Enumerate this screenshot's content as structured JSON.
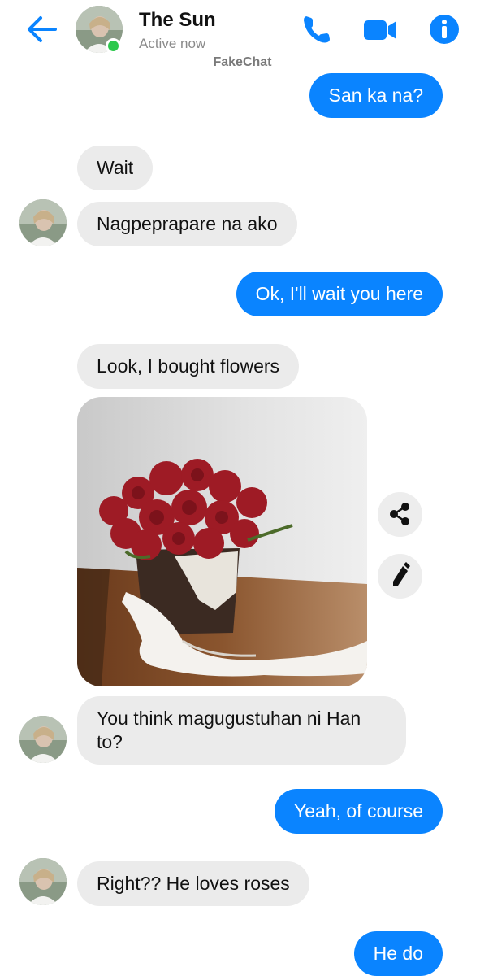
{
  "header": {
    "contact_name": "The Sun",
    "status": "Active now",
    "watermark": "FakeChat",
    "icons": [
      "back-arrow-icon",
      "phone-icon",
      "video-camera-icon",
      "info-icon"
    ],
    "colors": {
      "accent": "#0a84ff",
      "online": "#2dc84d"
    }
  },
  "messages": [
    {
      "direction": "outgoing",
      "text": "San ka na?"
    },
    {
      "direction": "incoming",
      "text": "Wait"
    },
    {
      "direction": "incoming",
      "text": "Nagpeprapare na ako"
    },
    {
      "direction": "outgoing",
      "text": "Ok, I'll wait you here"
    },
    {
      "direction": "incoming",
      "text": "Look, I bought flowers"
    },
    {
      "direction": "incoming",
      "type": "image",
      "content": "photo of red roses in a vase"
    },
    {
      "direction": "incoming",
      "text_line1": "You think magugustuhan ni Han",
      "text_line2": "to?"
    },
    {
      "direction": "outgoing",
      "text": "Yeah, of course"
    },
    {
      "direction": "incoming",
      "text": "Right?? He loves roses"
    },
    {
      "direction": "outgoing",
      "text": "He do"
    }
  ],
  "photo_actions": [
    "share-icon",
    "edit-icon"
  ],
  "bubble_colors": {
    "outgoing": "#0a84ff",
    "incoming": "#ebebeb"
  }
}
